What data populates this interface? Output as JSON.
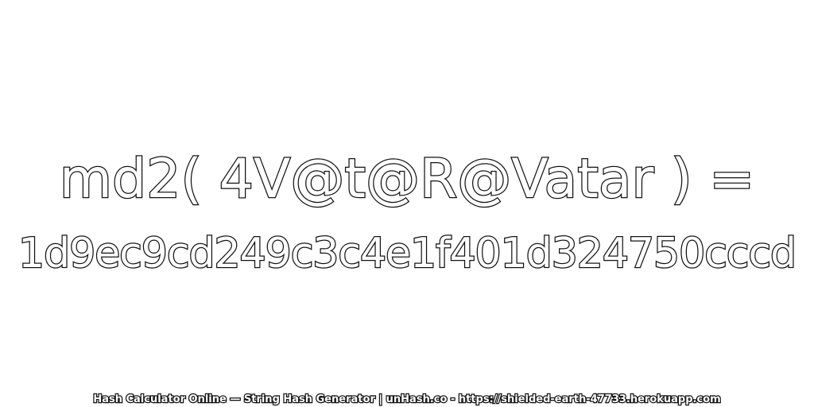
{
  "expression": "md2( 4V@t@R@Vatar ) =",
  "hash_value": "1d9ec9cd249c3c4e1f401d324750cccd",
  "footer": "Hash Calculator Online — String Hash Generator | unHash.co - https://shielded-earth-47733.herokuapp.com",
  "colors": {
    "background": "#ffffff",
    "text_fill": "#ffffff",
    "text_outline": "#111111"
  }
}
